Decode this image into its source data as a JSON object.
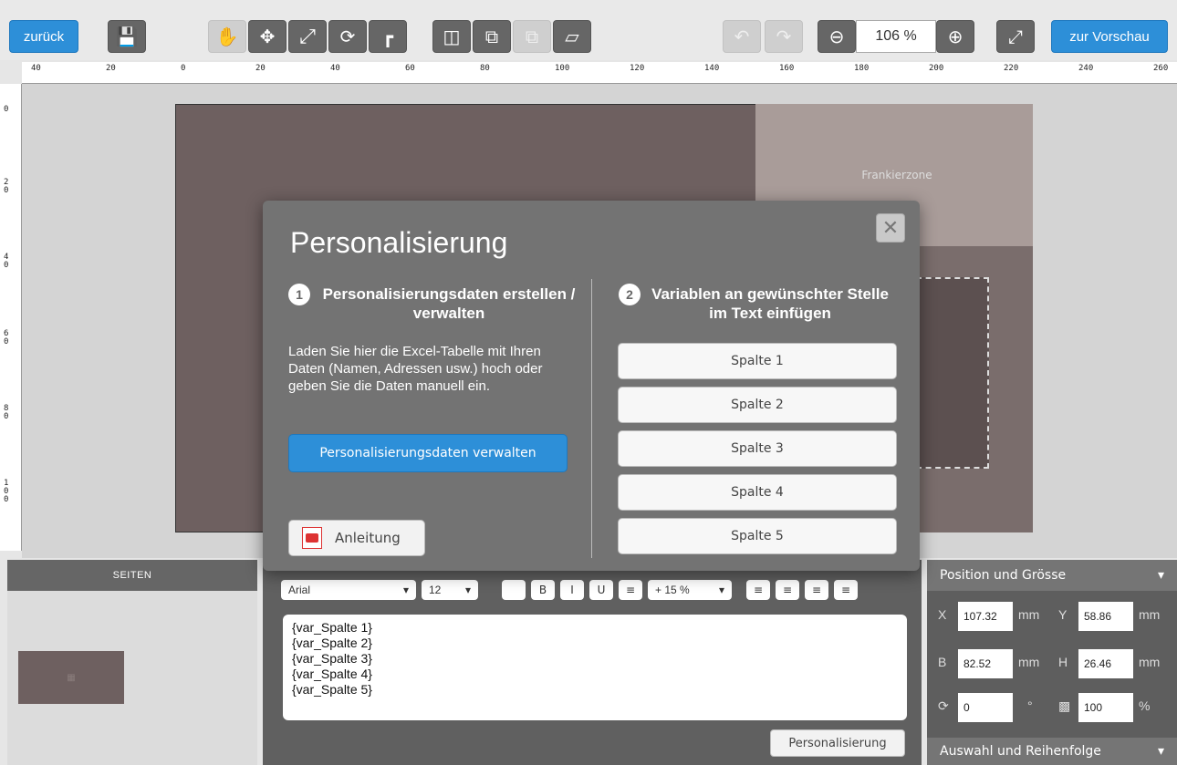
{
  "toolbar": {
    "back_label": "zurück",
    "preview_label": "zur Vorschau",
    "zoom_value": "106 %",
    "icons": {
      "save": "floppy-disk-icon",
      "hand": "hand-icon",
      "move": "move-arrows-icon",
      "resize": "diagonal-resize-icon",
      "rotate": "rotate-icon",
      "crop": "crop-icon",
      "swap": "swap-images-icon",
      "copy": "copy-icon",
      "paste": "paste-icon",
      "delete": "trash-icon",
      "undo": "undo-icon",
      "redo": "redo-icon",
      "zoom_out": "zoom-out-icon",
      "zoom_in": "zoom-in-icon",
      "fullscreen": "fullscreen-icon"
    }
  },
  "ruler": {
    "horizontal": [
      "40",
      "20",
      "0",
      "20",
      "40",
      "60",
      "80",
      "100",
      "120",
      "140",
      "160",
      "180",
      "200",
      "220",
      "240",
      "260"
    ],
    "vertical": [
      "0",
      "2\n0",
      "4\n0",
      "6\n0",
      "8\n0",
      "1\n0\n0"
    ]
  },
  "canvas": {
    "frank_label": "Frankierzone"
  },
  "modal": {
    "title": "Personalisierung",
    "step1": {
      "num": "1",
      "heading": "Personalisierungsdaten erstellen / verwalten",
      "description": "Laden Sie hier die Excel-Tabelle mit Ihren Daten (Namen, Adressen usw.) hoch oder geben Sie die Daten manuell ein.",
      "manage_label": "Personalisierungsdaten verwalten",
      "guide_label": "Anleitung"
    },
    "step2": {
      "num": "2",
      "heading": "Variablen an gewünschter Stelle im Text einfügen",
      "columns": [
        "Spalte 1",
        "Spalte 2",
        "Spalte 3",
        "Spalte 4",
        "Spalte 5"
      ]
    },
    "close_icon": "close-icon"
  },
  "pages_panel": {
    "title": "SEITEN"
  },
  "editor": {
    "font": "Arial",
    "size": "12",
    "line_spacing": "+ 15 %",
    "text": "{var_Spalte 1}\n{var_Spalte 2}\n{var_Spalte 3}\n{var_Spalte 4}\n{var_Spalte 5}",
    "personalisierung_label": "Personalisierung"
  },
  "position_panel": {
    "title": "Position und Grösse",
    "x_label": "X",
    "x_value": "107.32",
    "y_label": "Y",
    "y_value": "58.86",
    "b_label": "B",
    "b_value": "82.52",
    "h_label": "H",
    "h_value": "26.46",
    "rotation_value": "0",
    "rotation_unit": "°",
    "opacity_value": "100",
    "opacity_unit": "%",
    "unit": "mm",
    "footer_title": "Auswahl und Reihenfolge"
  },
  "colors": {
    "accent": "#2d8fd8",
    "card": "#6e6060",
    "modal_bg": "#737373"
  }
}
